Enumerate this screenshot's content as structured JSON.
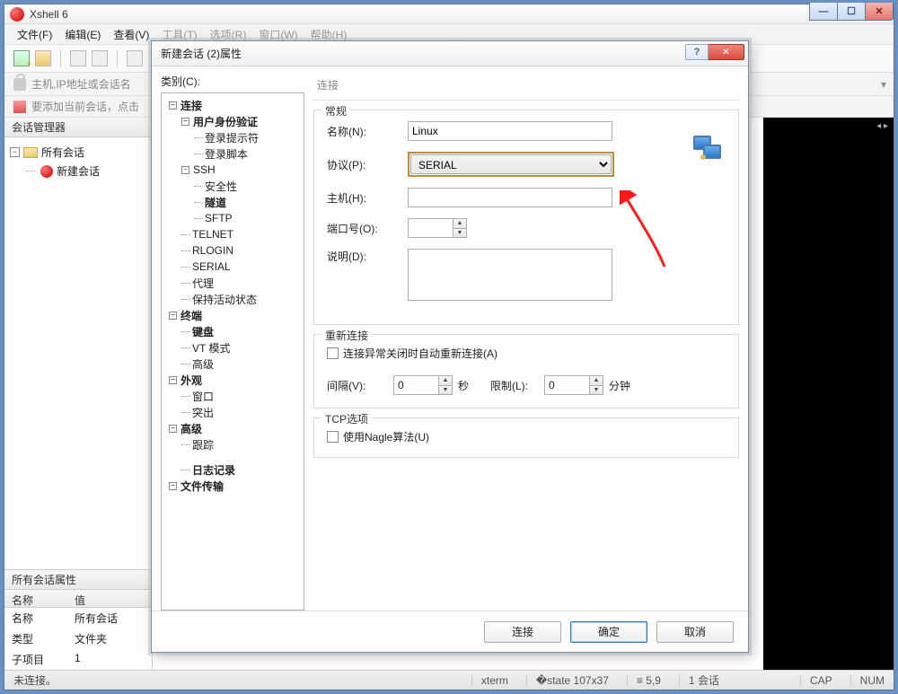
{
  "app": {
    "title": "Xshell 6"
  },
  "menubar": [
    "文件(F)",
    "编辑(E)",
    "查看(V)",
    "工具(T)",
    "选项(R)",
    "窗口(W)",
    "帮助(H)"
  ],
  "addr": {
    "placeholder": "主机,IP地址或会话名"
  },
  "hint": {
    "text": "要添加当前会话，点击"
  },
  "sessionMgr": {
    "title": "会话管理器",
    "rootLabel": "所有会话",
    "items": [
      {
        "label": "新建会话"
      }
    ]
  },
  "propsPane": {
    "title": "所有会话属性",
    "headers": {
      "name": "名称",
      "value": "值"
    },
    "rows": [
      {
        "k": "名称",
        "v": "所有会话"
      },
      {
        "k": "类型",
        "v": "文件夹"
      },
      {
        "k": "子项目",
        "v": "1"
      }
    ]
  },
  "status": {
    "left": "未连接。",
    "term": "xterm",
    "size": "�state 107x37",
    "pos": "≡ 5,9",
    "sessions": "1 会话",
    "cap": "CAP",
    "num": "NUM"
  },
  "dialog": {
    "title": "新建会话 (2)属性",
    "helpGlyph": "?",
    "closeGlyph": "✕",
    "catLabel": "类别(C):",
    "tree": {
      "conn": "连接",
      "auth": "用户身份验证",
      "loginPrompt": "登录提示符",
      "loginScript": "登录脚本",
      "ssh": "SSH",
      "security": "安全性",
      "tunnel": "隧道",
      "sftp": "SFTP",
      "telnet": "TELNET",
      "rlogin": "RLOGIN",
      "serial": "SERIAL",
      "proxy": "代理",
      "keepalive": "保持活动状态",
      "terminal": "终端",
      "keyboard": "键盘",
      "vtmode": "VT 模式",
      "tadv": "高级",
      "appearance": "外观",
      "window": "窗口",
      "popup": "突出",
      "advanced": "高级",
      "trace": "跟踪",
      "logging": "日志记录",
      "filetrans": "文件传输"
    },
    "form": {
      "headerTitle": "连接",
      "generalLegend": "常规",
      "nameLabel": "名称(N):",
      "nameValue": "Linux",
      "protoLabel": "协议(P):",
      "protoValue": "SERIAL",
      "hostLabel": "主机(H):",
      "hostValue": "",
      "portLabel": "端口号(O):",
      "portValue": "",
      "descLabel": "说明(D):",
      "descValue": "",
      "reconnLegend": "重新连接",
      "reconnChk": "连接异常关闭时自动重新连接(A)",
      "intervalLabel": "间隔(V):",
      "intervalValue": "0",
      "intervalUnit": "秒",
      "limitLabel": "限制(L):",
      "limitValue": "0",
      "limitUnit": "分钟",
      "tcpLegend": "TCP选项",
      "nagleChk": "使用Nagle算法(U)"
    },
    "buttons": {
      "connect": "连接",
      "ok": "确定",
      "cancel": "取消"
    }
  }
}
